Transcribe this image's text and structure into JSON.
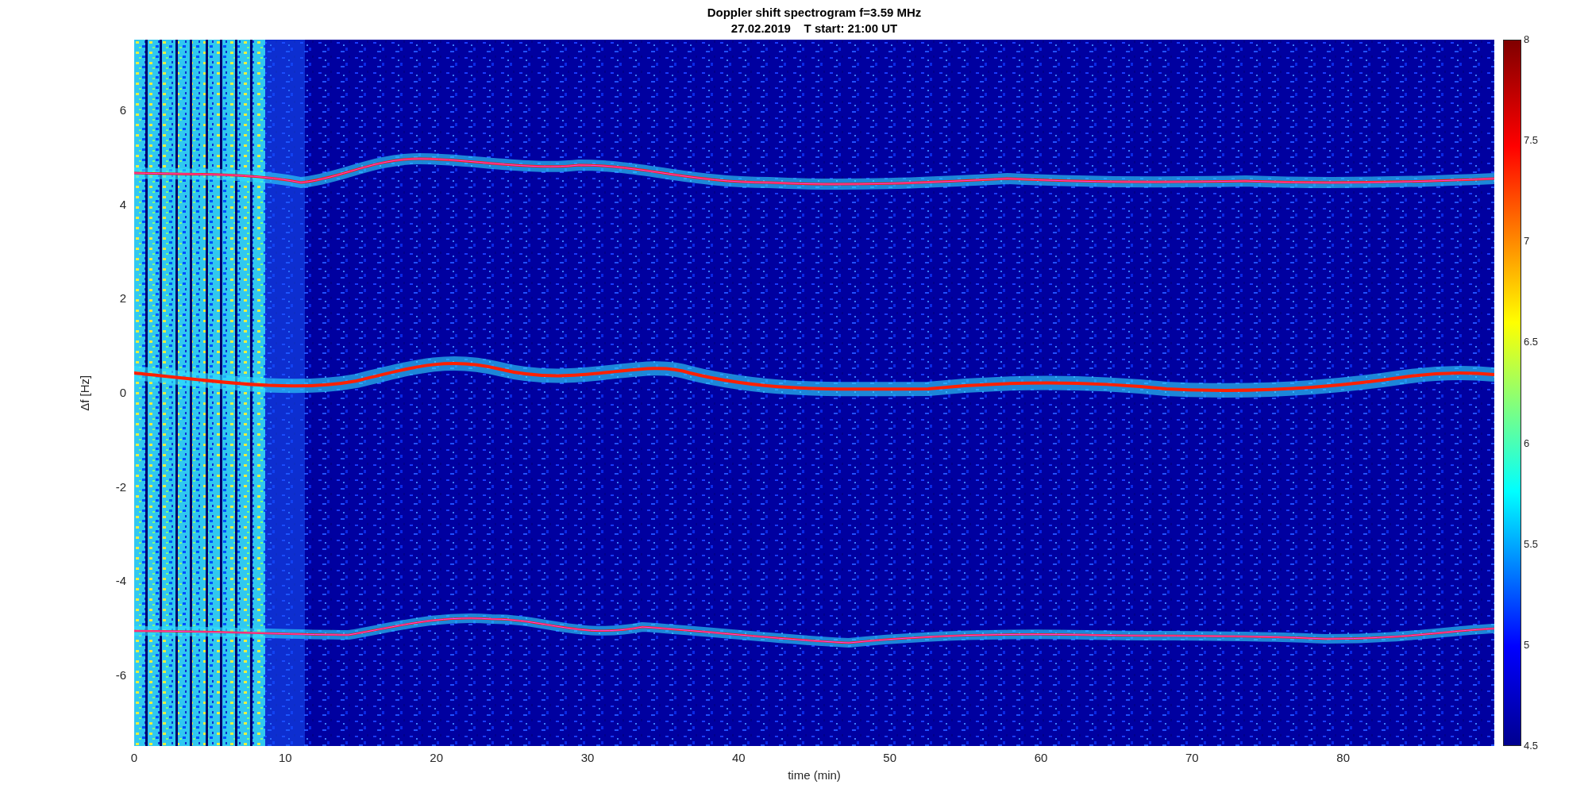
{
  "figure": {
    "title_lines": [
      "Doppler shift spectrogram f=3.59 MHz",
      "27.02.2019    T start: 21:00 UT"
    ],
    "xlabel": "time (min)",
    "ylabel": "Δf [Hz]",
    "xticks": [
      "0",
      "10",
      "20",
      "30",
      "40",
      "50",
      "60",
      "70",
      "80"
    ],
    "yticks": [
      "6",
      "4",
      "2",
      "0",
      "-2",
      "-4",
      "-6"
    ],
    "colorbar_ticks": [
      "8",
      "7.5",
      "7",
      "6.5",
      "6",
      "5.5",
      "5",
      "4.5"
    ]
  }
}
